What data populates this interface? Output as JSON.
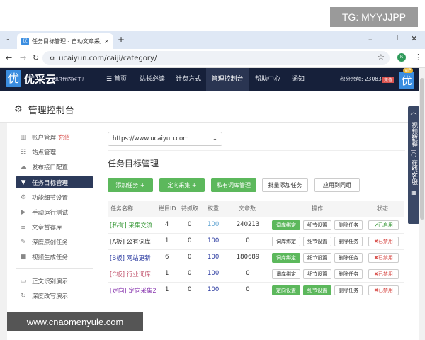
{
  "watermark_top": "TG: MYYJJPP",
  "watermark_bottom": "www.cnaomenyule.com",
  "browser": {
    "tab_title": "任务目标管理 - 自动文章采集",
    "url": "ucaiyun.com/caiji/category/",
    "profile": "R"
  },
  "site": {
    "logo": "优采云",
    "slogan": "AI时代内容工厂",
    "nav": [
      "首页",
      "站长必读",
      "计费方式",
      "管理控制台",
      "帮助中心",
      "通知"
    ],
    "active_nav": "管理控制台",
    "points_label": "积分余额: 2308333",
    "recharge": "充值",
    "vip": "VIP",
    "accent": "#16203a"
  },
  "page": {
    "title": "管理控制台"
  },
  "sidebar": {
    "items": [
      {
        "label": "账户管理",
        "badge": "充值",
        "icon": "bar-chart"
      },
      {
        "label": "站点管理",
        "icon": "list"
      },
      {
        "label": "发布接口配置",
        "icon": "cloud-upload"
      },
      {
        "label": "任务目标管理",
        "icon": "filter",
        "active": true
      },
      {
        "label": "功能细节设置",
        "icon": "gears"
      },
      {
        "label": "手动运行测试",
        "icon": "play-circle"
      },
      {
        "label": "文章暂存库",
        "icon": "database"
      },
      {
        "label": "深度原创任务",
        "icon": "edit"
      },
      {
        "label": "视频生成任务",
        "icon": "video"
      },
      {
        "label": "正文识别演示",
        "icon": "monitor"
      },
      {
        "label": "深度改写演示",
        "icon": "refresh"
      }
    ]
  },
  "main": {
    "site_select": "https://www.ucaiyun.com",
    "title": "任务目标管理",
    "buttons": [
      "添加任务 +",
      "定向采集 +",
      "私有词库管理",
      "批量添加任务",
      "应用到同组"
    ],
    "columns": [
      "任务名称",
      "栏目ID",
      "待抓取",
      "权重",
      "文章数",
      "操作",
      "状态"
    ],
    "rows": [
      {
        "name": "[私有] 采集交流",
        "color": "#3a9a3a",
        "id": "4",
        "pending": "0",
        "weight": "100",
        "count": "240213",
        "op1": "词库绑定",
        "op1_green": true,
        "op2": "细节设置",
        "op2_green": false,
        "op3": "删除任务",
        "status": "✔已启用",
        "enabled": true
      },
      {
        "name": "[A板] 公有词库",
        "color": "#333333",
        "id": "1",
        "pending": "0",
        "weight": "100",
        "count": "0",
        "op1": "词库绑定",
        "op1_green": false,
        "op2": "细节设置",
        "op2_green": false,
        "op3": "删除任务",
        "status": "✖已禁用",
        "enabled": false
      },
      {
        "name": "[B板] 网站更新",
        "color": "#2a3aa0",
        "id": "6",
        "pending": "0",
        "weight": "100",
        "count": "180689",
        "op1": "词库绑定",
        "op1_green": true,
        "op2": "细节设置",
        "op2_green": false,
        "op3": "删除任务",
        "status": "✖已禁用",
        "enabled": false
      },
      {
        "name": "[C板] 行业词库",
        "color": "#c0506a",
        "id": "1",
        "pending": "0",
        "weight": "100",
        "count": "0",
        "op1": "词库绑定",
        "op1_green": false,
        "op2": "细节设置",
        "op2_green": false,
        "op3": "删除任务",
        "status": "✖已禁用",
        "enabled": false
      },
      {
        "name": "[定向] 定向采集2",
        "color": "#8a3ab0",
        "id": "1",
        "pending": "0",
        "weight": "100",
        "count": "0",
        "op1": "定向设置",
        "op1_green": true,
        "op2": "细节设置",
        "op2_green": true,
        "op3": "删除任务",
        "status": "✖已禁用",
        "enabled": false
      }
    ]
  },
  "float_panel": {
    "top": "︿",
    "video": "视频教程",
    "service": "在线客服"
  }
}
